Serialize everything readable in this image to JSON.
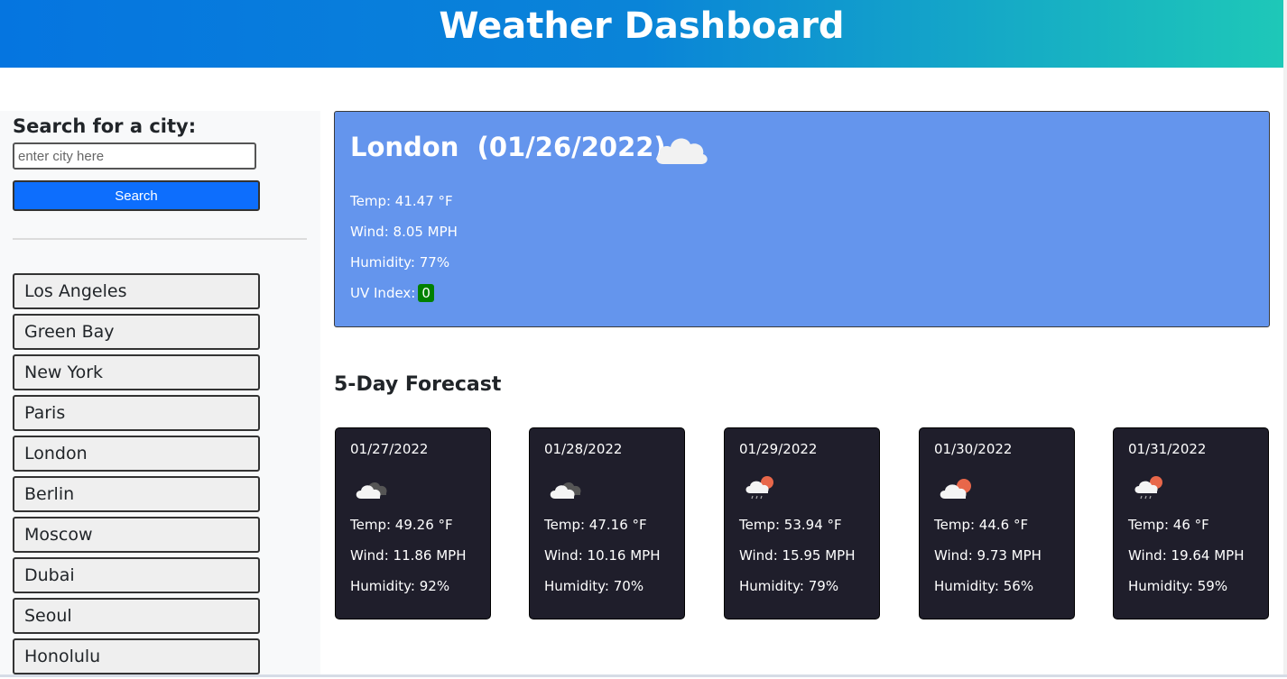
{
  "header": {
    "title": "Weather Dashboard"
  },
  "search": {
    "label": "Search for a city:",
    "placeholder": "enter city here",
    "button_label": "Search"
  },
  "history": [
    {
      "label": "Los Angeles"
    },
    {
      "label": "Green Bay"
    },
    {
      "label": "New York"
    },
    {
      "label": "Paris"
    },
    {
      "label": "London"
    },
    {
      "label": "Berlin"
    },
    {
      "label": "Moscow"
    },
    {
      "label": "Dubai"
    },
    {
      "label": "Seoul"
    },
    {
      "label": "Honolulu"
    }
  ],
  "current": {
    "title": "London  (01/26/2022)",
    "icon": "cloud-icon",
    "temp": "Temp: 41.47 °F",
    "wind": "Wind: 8.05 MPH",
    "humidity": "Humidity: 77%",
    "uv_label": "UV Index:",
    "uv_value": "0",
    "uv_color": "#008000"
  },
  "forecast": {
    "title": "5-Day Forecast",
    "days": [
      {
        "date": "01/27/2022",
        "icon": "broken-clouds-icon",
        "temp": "Temp: 49.26 °F",
        "wind": "Wind: 11.86 MPH",
        "humidity": "Humidity: 92%"
      },
      {
        "date": "01/28/2022",
        "icon": "broken-clouds-icon",
        "temp": "Temp: 47.16 °F",
        "wind": "Wind: 10.16 MPH",
        "humidity": "Humidity: 70%"
      },
      {
        "date": "01/29/2022",
        "icon": "rain-sun-icon",
        "temp": "Temp: 53.94 °F",
        "wind": "Wind: 15.95 MPH",
        "humidity": "Humidity: 79%"
      },
      {
        "date": "01/30/2022",
        "icon": "partly-cloudy-icon",
        "temp": "Temp: 44.6 °F",
        "wind": "Wind: 9.73 MPH",
        "humidity": "Humidity: 56%"
      },
      {
        "date": "01/31/2022",
        "icon": "rain-sun-icon",
        "temp": "Temp: 46 °F",
        "wind": "Wind: 19.64 MPH",
        "humidity": "Humidity: 59%"
      }
    ]
  },
  "colors": {
    "header_gradient_start": "#0575e0",
    "header_gradient_end": "#1ec8b8",
    "current_bg": "#6495ed",
    "card_bg": "#1f1e2b",
    "search_button": "#0d6efd"
  }
}
